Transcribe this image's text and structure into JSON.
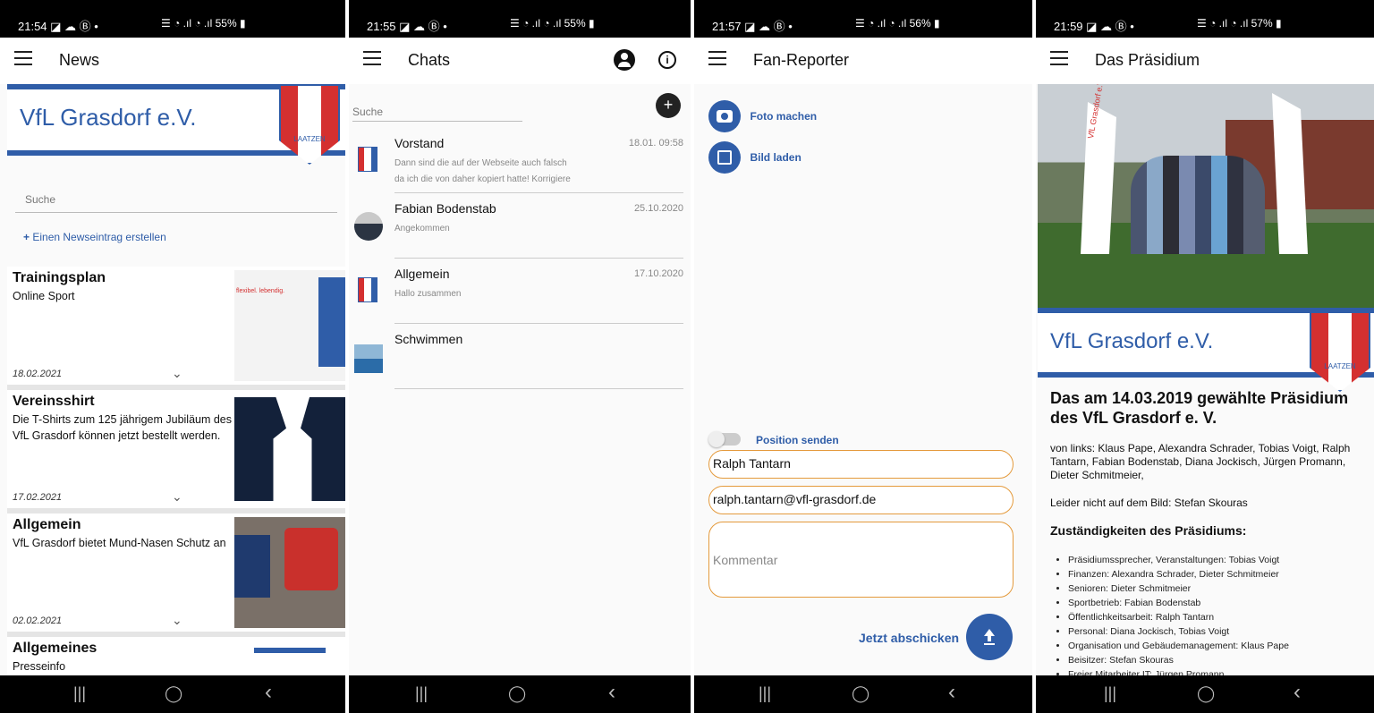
{
  "colors": {
    "accent": "#2f5da8",
    "red": "#d43030",
    "orange": "#e49a3c"
  },
  "screen1": {
    "status": {
      "time": "21:54 ◪ ☁ Ⓑ •",
      "right": "☰ ◔ .ıl ◔ .ıl 55% ▮"
    },
    "title": "News",
    "banner": {
      "text": "VfL Grasdorf e.V.",
      "shield_label": "LAATZEN"
    },
    "search_placeholder": "Suche",
    "create_link": "Einen Newseintrag erstellen",
    "news": [
      {
        "title": "Trainingsplan",
        "subtitle": "Online Sport",
        "date": "18.02.2021",
        "image_text": "flexibel. lebendig."
      },
      {
        "title": "Vereinsshirt",
        "subtitle": "Die T-Shirts zum 125 jährigem Jubiläum des VfL Grasdorf können jetzt bestellt werden.",
        "date": "17.02.2021"
      },
      {
        "title": "Allgemein",
        "subtitle": "VfL Grasdorf bietet Mund-Nasen Schutz an",
        "date": "02.02.2021"
      },
      {
        "title": "Allgemeines",
        "subtitle": "Presseinfo",
        "date": ""
      }
    ]
  },
  "screen2": {
    "status": {
      "time": "21:55 ◪ ☁ Ⓑ •",
      "right": "☰ ◔ .ıl ◔ .ıl 55% ▮"
    },
    "title": "Chats",
    "search_placeholder": "Suche",
    "chats": [
      {
        "name": "Vorstand",
        "date": "18.01. 09:58",
        "msg1": "Dann sind die auf der Webseite auch falsch",
        "msg2": "da ich die von daher kopiert hatte! Korrigiere"
      },
      {
        "name": "Fabian Bodenstab",
        "date": "25.10.2020",
        "msg1": "Angekommen",
        "msg2": ""
      },
      {
        "name": "Allgemein",
        "date": "17.10.2020",
        "msg1": "Hallo zusammen",
        "msg2": ""
      },
      {
        "name": "Schwimmen",
        "date": "",
        "msg1": "",
        "msg2": ""
      }
    ]
  },
  "screen3": {
    "status": {
      "time": "21:57 ◪ ☁ Ⓑ •",
      "right": "☰ ◔ .ıl ◔ .ıl 56% ▮"
    },
    "title": "Fan-Reporter",
    "photo_label": "Foto machen",
    "image_label": "Bild laden",
    "position_label": "Position senden",
    "name_value": "Ralph Tantarn",
    "email_value": "ralph.tantarn@vfl-grasdorf.de",
    "comment_placeholder": "Kommentar",
    "submit_label": "Jetzt abschicken"
  },
  "screen4": {
    "status": {
      "time": "21:59 ◪ ☁ Ⓑ •",
      "right": "☰ ◔ .ıl ◔ .ıl 57% ▮"
    },
    "title": "Das Präsidium",
    "banner": {
      "text": "VfL Grasdorf e.V.",
      "shield_label": "LAATZEN"
    },
    "flag_text": "VfL Grasdorf e.V.",
    "heading": "Das am 14.03.2019 gewählte Präsidium des VfL Grasdorf e. V.",
    "names": "von links: Klaus Pape, Alexandra Schrader, Tobias Voigt, Ralph Tantarn, Fabian Bodenstab, Diana Jockisch, Jürgen Promann, Dieter Schmitmeier,",
    "missing": "Leider nicht auf dem Bild: Stefan Skouras",
    "resp_heading": "Zuständigkeiten des Präsidiums:",
    "responsibilities": [
      "Präsidiumssprecher, Veranstaltungen: Tobias Voigt",
      "Finanzen:  Alexandra Schrader, Dieter Schmitmeier",
      "Senioren: Dieter Schmitmeier",
      "Sportbetrieb: Fabian Bodenstab",
      "Öffentlichkeitsarbeit: Ralph Tantarn",
      "Personal: Diana Jockisch, Tobias Voigt",
      "Organisation und Gebäudemanagement: Klaus Pape",
      "Beisitzer: Stefan Skouras",
      "Freier Mitarbeiter IT: Jürgen Promann"
    ]
  },
  "navbar": {
    "recents": "|||",
    "home": "◯",
    "back": "‹"
  }
}
